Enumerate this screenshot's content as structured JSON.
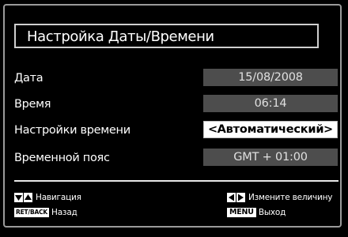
{
  "title": "Настройка Даты/Времени",
  "rows": [
    {
      "label": "Дата",
      "value": "15/08/2008"
    },
    {
      "label": "Время",
      "value": "06:14"
    },
    {
      "label": "Настройки времени",
      "value": "Автоматический"
    },
    {
      "label": "Временной пояс",
      "value": "GMT + 01:00"
    }
  ],
  "footer": {
    "nav_label": "Навигация",
    "back_key": "RET/BACK",
    "back_label": "Назад",
    "change_label": "Измените величину",
    "menu_key": "MENU",
    "exit_label": "Выход"
  },
  "icons": {
    "nav_keys": [
      "triangle-down-icon",
      "triangle-up-icon"
    ],
    "change_keys": [
      "triangle-left-icon",
      "triangle-right-icon"
    ],
    "option_arrows": [
      "chevron-left-icon",
      "chevron-right-icon"
    ]
  },
  "colors": {
    "background": "#000000",
    "value_field": "#4d4d4d",
    "selected_field": "#ffffff",
    "text": "#ffffff"
  }
}
